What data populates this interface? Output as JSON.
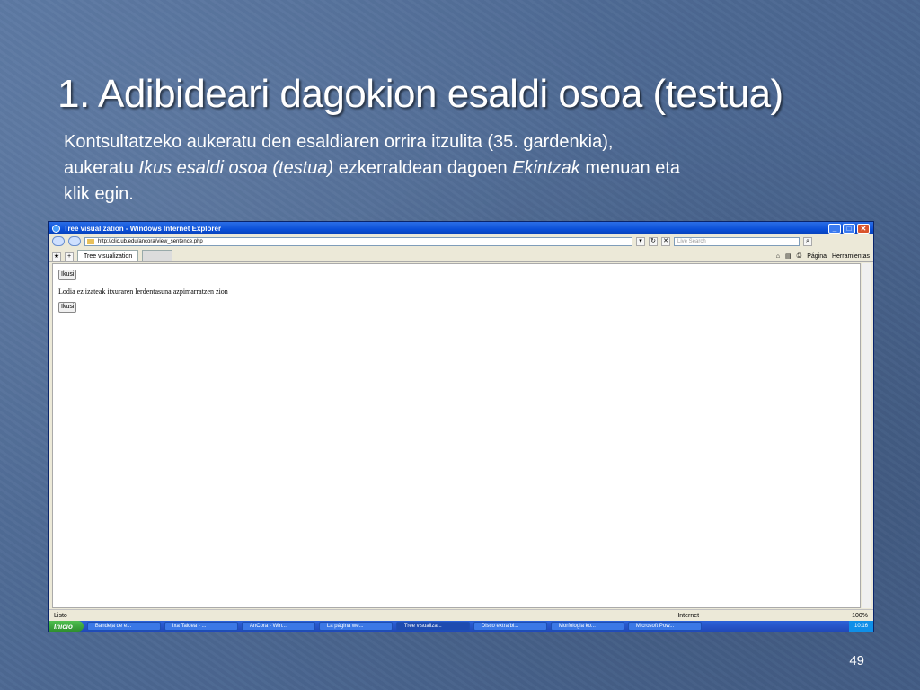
{
  "slide": {
    "title": "1. Adibideari dagokion esaldi osoa (testua)",
    "body_line1": "Kontsultatzeko aukeratu den esaldiaren orrira itzulita (35. gardenkia),",
    "body_line2_a": "aukeratu ",
    "body_line2_b": "Ikus esaldi osoa (testua)",
    "body_line2_c": " ezkerraldean dagoen ",
    "body_line2_d": "Ekintzak",
    "body_line2_e": " menuan eta",
    "body_line3": "klik egin.",
    "page_number": "49"
  },
  "browser": {
    "window_title": "Tree visualization - Windows Internet Explorer",
    "address": "http://clic.ub.edu/ancora/view_sentence.php",
    "search_placeholder": "Live Search",
    "tab_label": "Tree visualization",
    "cmd_pagina": "Página",
    "cmd_herramientas": "Herramientas",
    "page_button": "Ikusi",
    "sentence": "Lodia ez izateak itxuraren lerdentasuna azpimarratzen zion",
    "status_left": "Listo",
    "status_zone": "Internet",
    "status_zoom": "100%"
  },
  "taskbar": {
    "start": "Inicio",
    "items": [
      "Bandeja de e...",
      "Ixa Taldea - ...",
      "AnCora - Win...",
      "La página we...",
      "Tree visualiza...",
      "Disco extraíbl...",
      "Morfologia ko...",
      "Microsoft Pow..."
    ],
    "clock": "10:16"
  }
}
